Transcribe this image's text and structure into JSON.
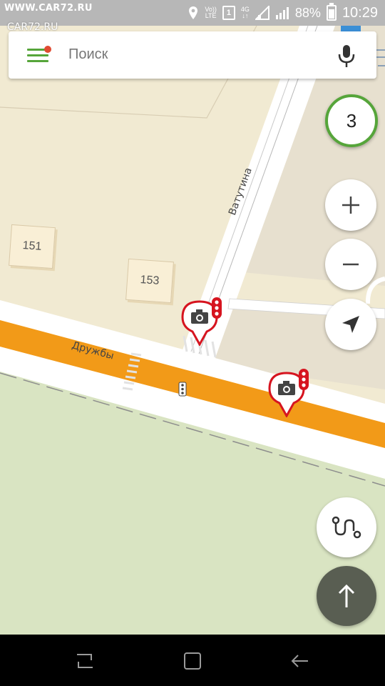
{
  "status_bar": {
    "watermark_top": "WWW.CAR72.RU",
    "watermark_logo": "CAR72.RU",
    "volte_top": "Vo))",
    "volte_bottom": "LTE",
    "sim_slot": "1",
    "network_top": "4G",
    "network_bottom": "↓↑",
    "battery_percent": "88%",
    "time": "10:29"
  },
  "search": {
    "placeholder": "Поиск"
  },
  "map": {
    "traffic_level": "3",
    "streets": {
      "vatutina": "Ватутина",
      "druzhby": "Дружбы"
    },
    "houses": [
      "151",
      "153"
    ],
    "colors": {
      "main_road": "#f29a18",
      "grass": "#d9e4c2",
      "land": "#f1ead2",
      "camera": "#d6141f"
    }
  },
  "icons": {
    "menu": "hamburger-menu-icon",
    "mic": "microphone-icon",
    "zoom_in": "plus-icon",
    "zoom_out": "minus-icon",
    "locate": "navigation-arrow-icon",
    "route": "route-icon",
    "go": "arrow-up-icon",
    "camera": "speed-camera-icon"
  }
}
